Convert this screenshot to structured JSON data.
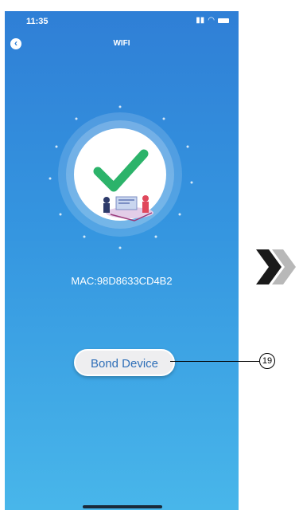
{
  "status_bar": {
    "time": "11:35",
    "signal_icon": "signal-icon",
    "wifi_icon": "wifi-icon",
    "battery_icon": "battery-icon"
  },
  "header": {
    "title": "WIFI",
    "back_icon": "back-icon"
  },
  "main": {
    "mac_label": "MAC:98D8633CD4B2",
    "bond_button_label": "Bond Device"
  },
  "annotation": {
    "callout_number": "19"
  },
  "colors": {
    "gradient_top": "#2f7fd6",
    "gradient_bottom": "#48b6ea",
    "check_green": "#2cb36a",
    "button_text": "#2f6fb8"
  }
}
